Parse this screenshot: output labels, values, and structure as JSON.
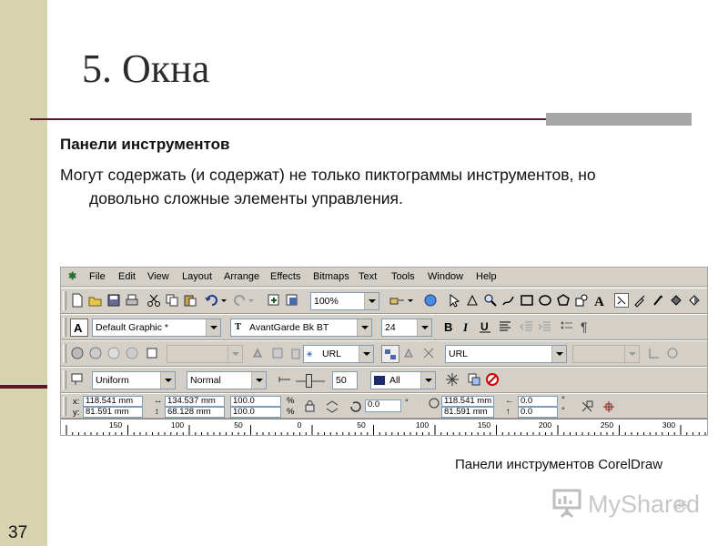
{
  "slide": {
    "title": "5. Окна",
    "subtitle": "Панели инструментов",
    "body_line1": "Могут содержать (и содержат) не только пиктограммы инструментов, но",
    "body_line2": "довольно сложные элементы управления.",
    "caption": "Панели инструментов CorelDraw",
    "slide_number": "37",
    "watermark_text": "MyShared",
    "watermark_number": "36"
  },
  "colors": {
    "band": "#d7d3ae",
    "accent_dark": "#5a1a2e",
    "toolbar_bg": "#d4d0c8"
  },
  "menu": [
    "File",
    "Edit",
    "View",
    "Layout",
    "Arrange",
    "Effects",
    "Bitmaps",
    "Text",
    "Tools",
    "Window",
    "Help"
  ],
  "standard_toolbar": {
    "zoom_value": "100%"
  },
  "text_toolbar": {
    "style_value": "Default Graphic *",
    "font_value": "AvantGarde Bk BT",
    "size_value": "24"
  },
  "internet_toolbar": {
    "url_combo_1": "URL",
    "url_combo_2": "URL"
  },
  "outline_toolbar": {
    "width_value": "Uniform",
    "mode_value": "Normal",
    "transparency_value": "50",
    "target_value": "All"
  },
  "property_bar": {
    "x_label": "x:",
    "x_value": "118.541 mm",
    "y_label": "y:",
    "y_value": "81.591 mm",
    "width_value": "134.537 mm",
    "height_value": "68.128 mm",
    "scale_x": "100.0",
    "scale_y": "100.0",
    "percent": "%",
    "angle_value": "0.0",
    "degree": "°",
    "center_x": "118.541 mm",
    "center_y": "81.591 mm",
    "skew_x": "0.0",
    "skew_y": "0.0"
  },
  "ruler": {
    "ticks": [
      "150",
      "100",
      "50",
      "0",
      "50",
      "100",
      "150",
      "200",
      "250",
      "300"
    ]
  }
}
